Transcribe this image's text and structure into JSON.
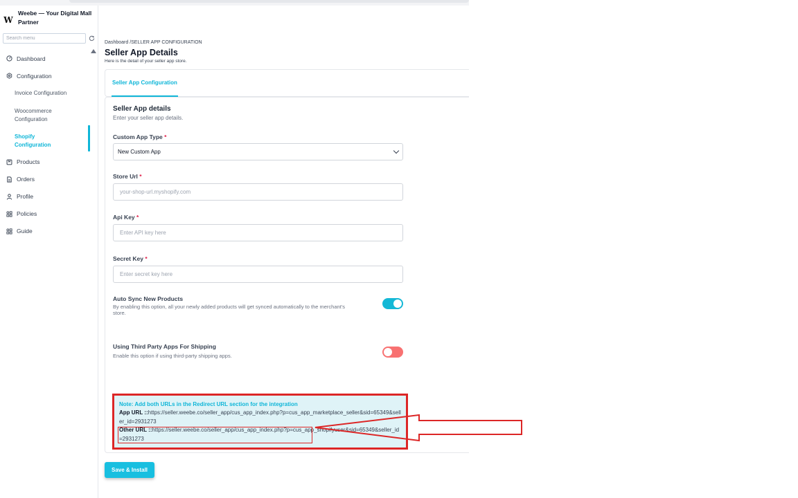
{
  "app": {
    "logo_letter": "W",
    "name": "Weebe — Your Digital Mall Partner"
  },
  "sidebar": {
    "search_placeholder": "Search menu",
    "items": [
      {
        "label": "Dashboard",
        "icon": "dashboard-icon"
      },
      {
        "label": "Configuration",
        "icon": "settings-icon"
      }
    ],
    "sub_items": [
      {
        "label": "Invoice Configuration"
      },
      {
        "label": "Woocommerce Configuration"
      },
      {
        "label": "Shopify Configuration"
      }
    ],
    "items_after": [
      {
        "label": "Products",
        "icon": "products-icon"
      },
      {
        "label": "Orders",
        "icon": "orders-icon"
      },
      {
        "label": "Profile",
        "icon": "profile-icon"
      },
      {
        "label": "Policies",
        "icon": "policies-icon"
      },
      {
        "label": "Guide",
        "icon": "guide-icon"
      }
    ]
  },
  "page": {
    "breadcrumb": "Dashboard /SELLER APP CONFIGURATION",
    "title": "Seller App Details",
    "subtitle": "Here is the detail of your seller app store."
  },
  "tabs": [
    {
      "label": "Seller App Configuration",
      "active": true
    }
  ],
  "form": {
    "section_title": "Seller App details",
    "section_subtitle": "Enter your seller app details.",
    "custom_app_type": {
      "label": "Custom App Type",
      "required": "*",
      "value": "New Custom App"
    },
    "store_url": {
      "label": "Store Url",
      "required": "*",
      "placeholder": "your-shop-url.myshopify.com"
    },
    "api_key": {
      "label": "Api Key",
      "required": "*",
      "placeholder": "Enter API key here"
    },
    "secret_key": {
      "label": "Secret Key",
      "required": "*",
      "placeholder": "Enter secret key here"
    },
    "auto_sync": {
      "title": "Auto Sync New Products",
      "description": "By enabling this option, all your newly added products will get synced automatically to the merchant's store.",
      "enabled": true
    },
    "third_party_shipping": {
      "title": "Using Third Party Apps For Shipping",
      "description": "Enable this option if using third-party shipping apps.",
      "enabled": false
    },
    "note": {
      "heading": "Note: Add both URLs in the Redirect URL section for the integration",
      "app_url_label": "App URL ::",
      "app_url": "https://seller.weebe.co/seller_app/cus_app_index.php?p=cus_app_marketplace_seller&sid=65349&seller_id=2931273",
      "other_url_label": "Other URL ::",
      "other_url": "https://seller.weebe.co/seller_app/cus_app_index.php?p=cus_app_shopifyuser&sid=65349&seller_id=2931273"
    },
    "save_label": "Save & Install"
  },
  "colors": {
    "accent": "#0fb6d8",
    "toggle_on": "#14b8d6",
    "toggle_off": "#f87171",
    "annotation_red": "#dc2626",
    "note_bg": "#dff3f7"
  }
}
